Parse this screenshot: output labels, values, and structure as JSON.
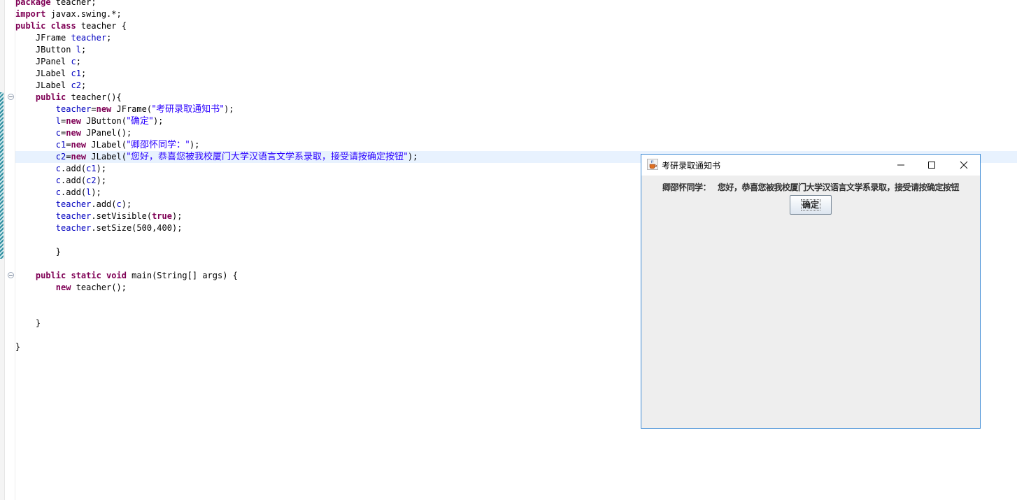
{
  "editor": {
    "lines": [
      {
        "segments": [
          {
            "t": "package",
            "c": "kw"
          },
          {
            "t": " teacher;"
          }
        ]
      },
      {
        "segments": [
          {
            "t": "import",
            "c": "kw"
          },
          {
            "t": " javax.swing.*;"
          }
        ]
      },
      {
        "segments": [
          {
            "t": "public class",
            "c": "kw"
          },
          {
            "t": " teacher {"
          }
        ]
      },
      {
        "segments": [
          {
            "t": "    JFrame "
          },
          {
            "t": "teacher",
            "c": "fld"
          },
          {
            "t": ";"
          }
        ]
      },
      {
        "segments": [
          {
            "t": "    JButton "
          },
          {
            "t": "l",
            "c": "fld"
          },
          {
            "t": ";"
          }
        ]
      },
      {
        "segments": [
          {
            "t": "    JPanel "
          },
          {
            "t": "c",
            "c": "fld"
          },
          {
            "t": ";"
          }
        ]
      },
      {
        "segments": [
          {
            "t": "    JLabel "
          },
          {
            "t": "c1",
            "c": "fld"
          },
          {
            "t": ";"
          }
        ]
      },
      {
        "segments": [
          {
            "t": "    JLabel "
          },
          {
            "t": "c2",
            "c": "fld"
          },
          {
            "t": ";"
          }
        ]
      },
      {
        "segments": [
          {
            "t": "    "
          },
          {
            "t": "public",
            "c": "kw"
          },
          {
            "t": " teacher(){"
          }
        ]
      },
      {
        "segments": [
          {
            "t": "        "
          },
          {
            "t": "teacher",
            "c": "fld"
          },
          {
            "t": "="
          },
          {
            "t": "new",
            "c": "kw"
          },
          {
            "t": " JFrame("
          },
          {
            "t": "\"考研录取通知书\"",
            "c": "str cjk"
          },
          {
            "t": ");"
          }
        ]
      },
      {
        "segments": [
          {
            "t": "        "
          },
          {
            "t": "l",
            "c": "fld"
          },
          {
            "t": "="
          },
          {
            "t": "new",
            "c": "kw"
          },
          {
            "t": " JButton("
          },
          {
            "t": "\"确定\"",
            "c": "str cjk"
          },
          {
            "t": ");"
          }
        ]
      },
      {
        "segments": [
          {
            "t": "        "
          },
          {
            "t": "c",
            "c": "fld"
          },
          {
            "t": "="
          },
          {
            "t": "new",
            "c": "kw"
          },
          {
            "t": " JPanel();"
          }
        ]
      },
      {
        "segments": [
          {
            "t": "        "
          },
          {
            "t": "c1",
            "c": "fld"
          },
          {
            "t": "="
          },
          {
            "t": "new",
            "c": "kw"
          },
          {
            "t": " JLabel("
          },
          {
            "t": "\"卿邵怀同学：\"",
            "c": "str cjk"
          },
          {
            "t": ");"
          }
        ]
      },
      {
        "current": true,
        "segments": [
          {
            "t": "        "
          },
          {
            "t": "c2",
            "c": "fld"
          },
          {
            "t": "="
          },
          {
            "t": "new",
            "c": "kw"
          },
          {
            "t": " JLabel("
          },
          {
            "t": "\"您好，恭喜您被我校厦门大学汉语言文学系录取，接受请按确定按钮\"",
            "c": "str cjk"
          },
          {
            "t": ");"
          }
        ]
      },
      {
        "segments": [
          {
            "t": "        "
          },
          {
            "t": "c",
            "c": "fld"
          },
          {
            "t": ".add("
          },
          {
            "t": "c1",
            "c": "fld"
          },
          {
            "t": ");"
          }
        ]
      },
      {
        "segments": [
          {
            "t": "        "
          },
          {
            "t": "c",
            "c": "fld"
          },
          {
            "t": ".add("
          },
          {
            "t": "c2",
            "c": "fld"
          },
          {
            "t": ");"
          }
        ]
      },
      {
        "segments": [
          {
            "t": "        "
          },
          {
            "t": "c",
            "c": "fld"
          },
          {
            "t": ".add("
          },
          {
            "t": "l",
            "c": "fld"
          },
          {
            "t": ");"
          }
        ]
      },
      {
        "segments": [
          {
            "t": "        "
          },
          {
            "t": "teacher",
            "c": "fld"
          },
          {
            "t": ".add("
          },
          {
            "t": "c",
            "c": "fld"
          },
          {
            "t": ");"
          }
        ]
      },
      {
        "segments": [
          {
            "t": "        "
          },
          {
            "t": "teacher",
            "c": "fld"
          },
          {
            "t": ".setVisible("
          },
          {
            "t": "true",
            "c": "kw"
          },
          {
            "t": ");"
          }
        ]
      },
      {
        "segments": [
          {
            "t": "        "
          },
          {
            "t": "teacher",
            "c": "fld"
          },
          {
            "t": ".setSize(500,400);"
          }
        ]
      },
      {
        "segments": [
          {
            "t": ""
          }
        ]
      },
      {
        "segments": [
          {
            "t": "        }"
          }
        ]
      },
      {
        "segments": [
          {
            "t": ""
          }
        ]
      },
      {
        "segments": [
          {
            "t": "    "
          },
          {
            "t": "public static void",
            "c": "kw"
          },
          {
            "t": " main(String[] args) {"
          }
        ]
      },
      {
        "segments": [
          {
            "t": "        "
          },
          {
            "t": "new",
            "c": "kw"
          },
          {
            "t": " teacher();"
          }
        ]
      },
      {
        "segments": [
          {
            "t": ""
          }
        ]
      },
      {
        "segments": [
          {
            "t": ""
          }
        ]
      },
      {
        "segments": [
          {
            "t": "    }"
          }
        ]
      },
      {
        "segments": [
          {
            "t": ""
          }
        ]
      },
      {
        "segments": [
          {
            "t": "}"
          }
        ]
      }
    ]
  },
  "window": {
    "title": "考研录取通知书",
    "label1": "卿邵怀同学：",
    "label2": "您好，恭喜您被我校厦门大学汉语言文学系录取，接受请按确定按钮",
    "button_label": "确定"
  },
  "colors": {
    "keyword": "#7f0055",
    "field": "#0000c0",
    "string": "#2a00ff",
    "window_border": "#3c8ad4",
    "panel_bg": "#eeeeee"
  },
  "icons": {
    "app": "java-cup-icon",
    "minimize": "minimize-icon",
    "maximize": "maximize-icon",
    "close": "close-icon",
    "fold": "fold-collapse-icon"
  }
}
